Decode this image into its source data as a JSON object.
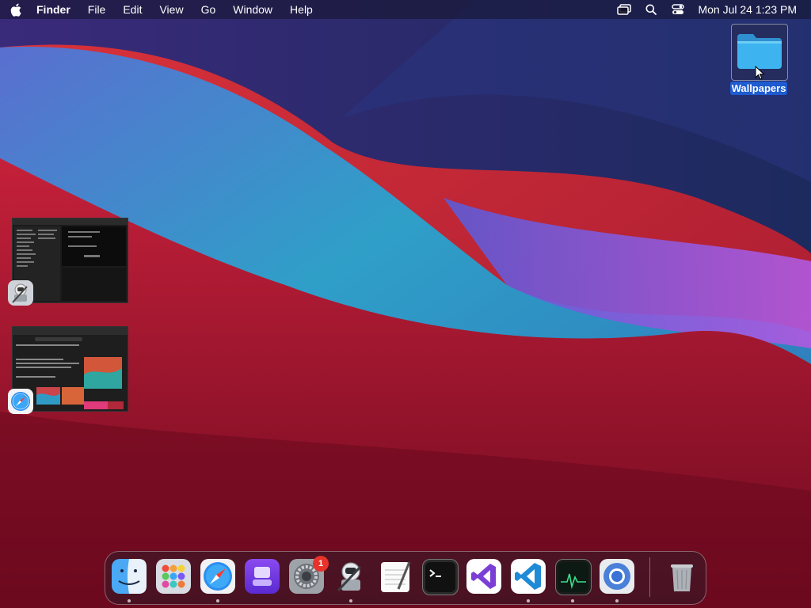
{
  "menubar": {
    "apple_icon": "apple-logo-icon",
    "app_name": "Finder",
    "menus": [
      "File",
      "Edit",
      "View",
      "Go",
      "Window",
      "Help"
    ],
    "status_icons": [
      "screen-mirroring-icon",
      "spotlight-search-icon",
      "control-center-icon"
    ],
    "clock": "Mon Jul 24  1:23 PM"
  },
  "desktop": {
    "folder": {
      "label": "Wallpapers",
      "icon": "folder-icon",
      "selected": true
    }
  },
  "minimized_windows": [
    {
      "app": "Automator",
      "badge_icon": "automator-icon"
    },
    {
      "app": "Safari",
      "badge_icon": "safari-icon"
    }
  ],
  "dock": {
    "apps": [
      {
        "name": "Finder",
        "icon": "finder-icon",
        "running": true
      },
      {
        "name": "Launchpad",
        "icon": "launchpad-icon",
        "running": false
      },
      {
        "name": "Safari",
        "icon": "safari-icon",
        "running": true
      },
      {
        "name": "Apple Configurator",
        "icon": "configurator-icon",
        "running": false
      },
      {
        "name": "System Settings",
        "icon": "system-settings-icon",
        "running": false,
        "badge": "1"
      },
      {
        "name": "Automator",
        "icon": "automator-icon",
        "running": true
      },
      {
        "name": "TextEdit",
        "icon": "textedit-icon",
        "running": false
      },
      {
        "name": "Terminal",
        "icon": "terminal-icon",
        "running": false
      },
      {
        "name": "Visual Studio",
        "icon": "visual-studio-icon",
        "running": false
      },
      {
        "name": "Visual Studio Code",
        "icon": "vscode-icon",
        "running": true
      },
      {
        "name": "Activity Monitor",
        "icon": "activity-monitor-icon",
        "running": true
      },
      {
        "name": "Chromium",
        "icon": "chromium-icon",
        "running": true
      },
      {
        "name": "Trash",
        "icon": "trash-icon",
        "running": false
      }
    ]
  },
  "colors": {
    "selection_blue": "#1f5bd1",
    "badge_red": "#e8322a"
  }
}
